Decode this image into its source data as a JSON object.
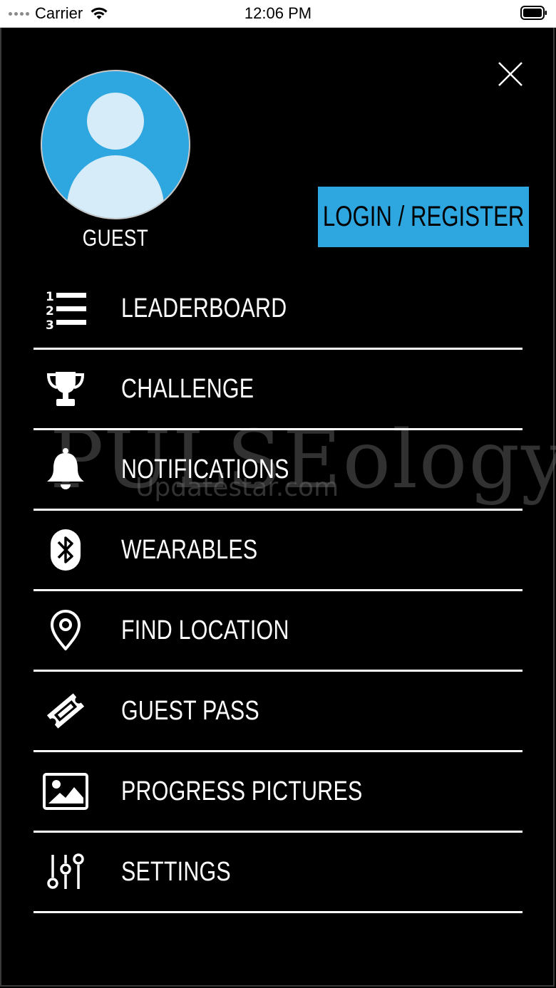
{
  "status_bar": {
    "carrier": "Carrier",
    "time": "12:06 PM"
  },
  "profile": {
    "name": "GUEST"
  },
  "actions": {
    "login_register": "LOGIN / REGISTER"
  },
  "menu": {
    "items": [
      {
        "label": "LEADERBOARD",
        "icon": "leaderboard-icon"
      },
      {
        "label": "CHALLENGE",
        "icon": "trophy-icon"
      },
      {
        "label": "NOTIFICATIONS",
        "icon": "bell-icon"
      },
      {
        "label": "WEARABLES",
        "icon": "bluetooth-icon"
      },
      {
        "label": "FIND LOCATION",
        "icon": "location-pin-icon"
      },
      {
        "label": "GUEST PASS",
        "icon": "ticket-icon"
      },
      {
        "label": "PROGRESS PICTURES",
        "icon": "picture-icon"
      },
      {
        "label": "SETTINGS",
        "icon": "sliders-icon"
      }
    ]
  },
  "watermark": {
    "logo": "PULSEology",
    "site": "Updatestar.com"
  },
  "colors": {
    "accent": "#2ea6e0",
    "background": "#000000",
    "text": "#ffffff"
  }
}
